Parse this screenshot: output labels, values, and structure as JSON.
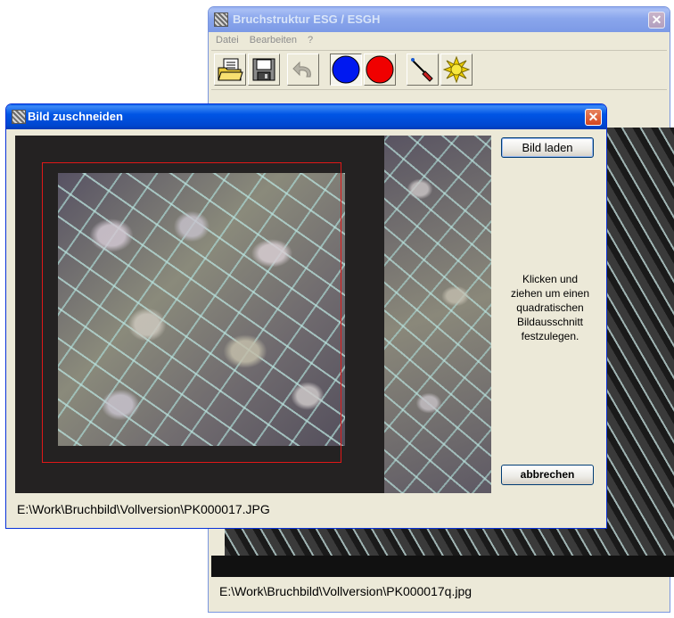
{
  "main_window": {
    "title": "Bruchstruktur ESG / ESGH",
    "close_glyph": "✕",
    "menu": [
      "Datei",
      "Bearbeiten",
      "?"
    ],
    "toolbar": [
      {
        "name": "open-folder-icon"
      },
      {
        "name": "save-disk-icon"
      },
      {
        "name": "undo-arrow-icon"
      },
      {
        "name": "blue-circle-icon",
        "color": "#0018f0"
      },
      {
        "name": "red-circle-icon",
        "color": "#f00000"
      },
      {
        "name": "pen-tool-icon"
      },
      {
        "name": "sun-icon",
        "color": "#f0d000"
      }
    ],
    "status_path": "E:\\Work\\Bruchbild\\Vollversion\\PK000017q.jpg"
  },
  "dialog": {
    "title": "Bild zuschneiden",
    "close_glyph": "✕",
    "load_button": "Bild laden",
    "hint_lines": [
      "Klicken und",
      "ziehen um einen",
      "quadratischen",
      "Bildausschnitt",
      "festzulegen."
    ],
    "cancel_button": "abbrechen",
    "file_path": "E:\\Work\\Bruchbild\\Vollversion\\PK000017.JPG",
    "crop_color": "#e01818"
  }
}
